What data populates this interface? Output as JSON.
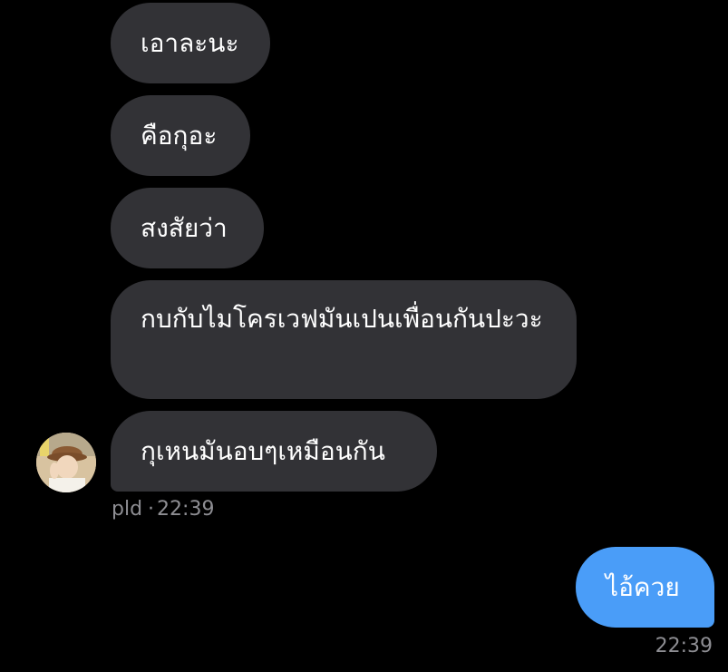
{
  "conversation": {
    "received_messages": [
      {
        "text": "เอาละนะ"
      },
      {
        "text": "คือกุอะ"
      },
      {
        "text": "สงสัยว่า"
      },
      {
        "text": "กบกับไมโครเวฟมันเปนเพื่อนกันปะวะ"
      },
      {
        "text": "กุเหนมันอบๆเหมือนกัน"
      }
    ],
    "received_meta": {
      "sender": "pld",
      "separator": "·",
      "time": "22:39"
    },
    "sent_messages": [
      {
        "text": "ไอ้ควย"
      }
    ],
    "sent_meta": {
      "time": "22:39"
    },
    "colors": {
      "background": "#000000",
      "received_bubble": "#323236",
      "sent_bubble": "#4a9df8",
      "meta_text": "#8e8e93"
    }
  }
}
